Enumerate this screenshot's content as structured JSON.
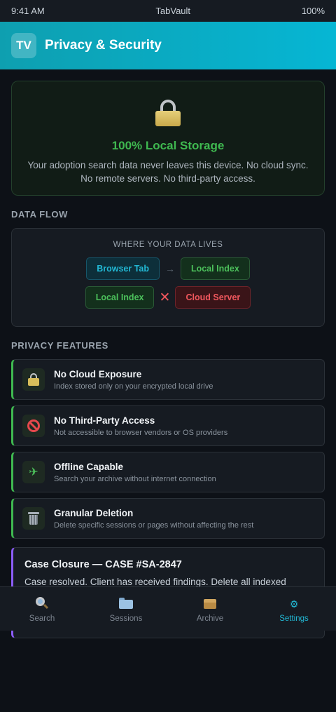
{
  "status_bar": {
    "time": "9:41 AM",
    "app": "TabVault",
    "battery": "100%"
  },
  "header": {
    "logo": "TV",
    "title": "Privacy & Security"
  },
  "hero": {
    "icon": "lock-icon",
    "title": "100% Local Storage",
    "line1": "Your adoption search data never leaves this device. No cloud sync.",
    "line2": "No remote servers. No third-party access."
  },
  "data_flow": {
    "section_label": "DATA FLOW",
    "caption": "WHERE YOUR DATA LIVES",
    "row1": {
      "from": "Browser Tab",
      "to": "Local Index",
      "connector": "→"
    },
    "row2": {
      "from": "Local Index",
      "to": "Cloud Server",
      "connector": "✕"
    }
  },
  "features": {
    "section_label": "PRIVACY FEATURES",
    "items": [
      {
        "icon": "lock-icon",
        "title": "No Cloud Exposure",
        "desc": "Index stored only on your encrypted local drive"
      },
      {
        "icon": "prohibited-icon",
        "title": "No Third-Party Access",
        "desc": "Not accessible to browser vendors or OS providers"
      },
      {
        "icon": "airplane-icon",
        "title": "Offline Capable",
        "desc": "Search your archive without internet connection"
      },
      {
        "icon": "trash-icon",
        "title": "Granular Deletion",
        "desc": "Delete specific sessions or pages without affecting the rest"
      }
    ]
  },
  "case": {
    "title": "Case Closure — CASE #SA-2847",
    "desc": "Case resolved. Client has received findings. Delete all indexed"
  },
  "tabs": [
    {
      "label": "Search",
      "icon": "search-icon"
    },
    {
      "label": "Sessions",
      "icon": "folder-icon"
    },
    {
      "label": "Archive",
      "icon": "archive-box-icon"
    },
    {
      "label": "Settings",
      "icon": "gear-icon",
      "glyph": "⚙"
    }
  ],
  "colors": {
    "accent": "#06b6d4",
    "success": "#3fb950",
    "danger": "#f0575d",
    "case_accent": "#8b5cf6",
    "background": "#0d1117"
  }
}
